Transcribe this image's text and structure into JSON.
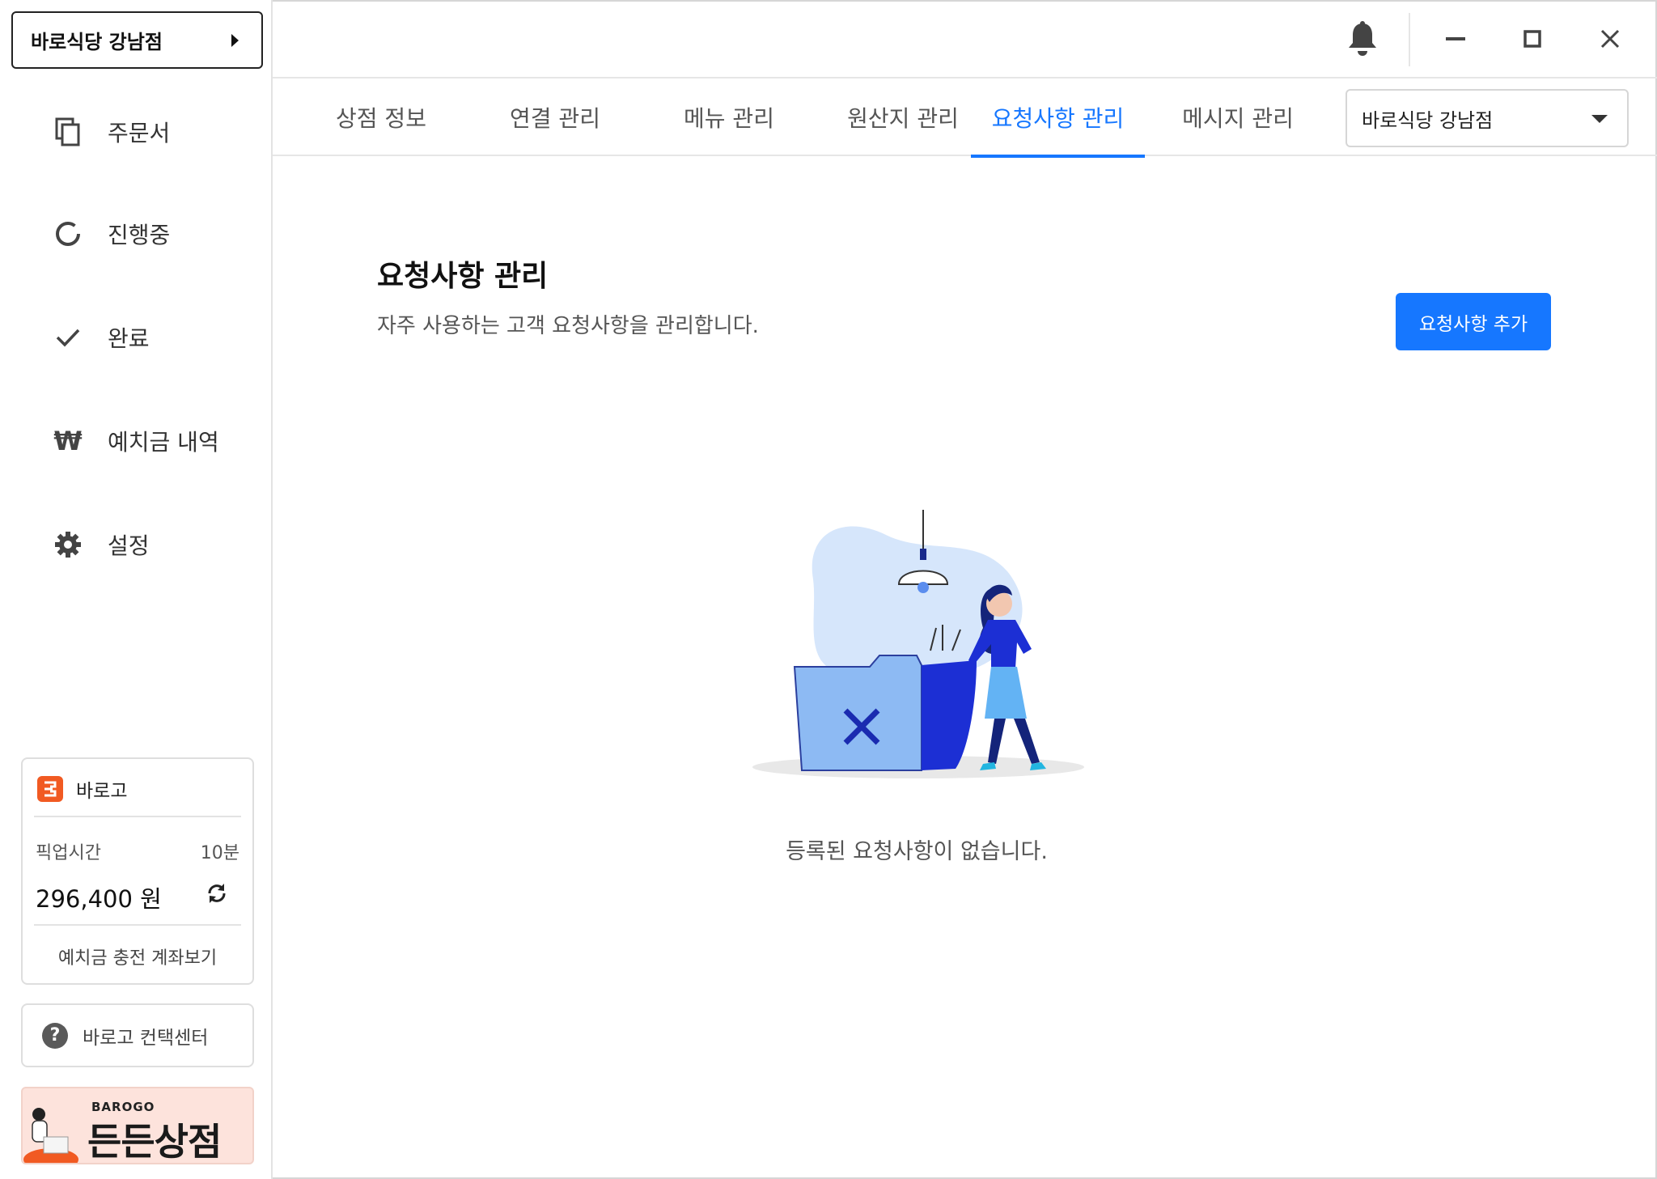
{
  "sidebar": {
    "store_button": "바로식당 강남점",
    "nav": [
      {
        "label": "주문서",
        "icon": "copy-icon"
      },
      {
        "label": "진행중",
        "icon": "progress-ring-icon"
      },
      {
        "label": "완료",
        "icon": "check-icon"
      },
      {
        "label": "예치금 내역",
        "icon": "won-icon"
      },
      {
        "label": "설정",
        "icon": "gear-icon"
      }
    ],
    "barogo_card": {
      "brand": "바로고",
      "pickup_label": "픽업시간",
      "pickup_value": "10분",
      "balance": "296,400 원",
      "view_account": "예치금 충전 계좌보기"
    },
    "contact": "바로고 컨택센터",
    "banner": {
      "small": "BAROGO",
      "big": "든든상점"
    }
  },
  "tabs": [
    "상점 정보",
    "연결 관리",
    "메뉴 관리",
    "원산지 관리",
    "요청사항 관리",
    "메시지 관리"
  ],
  "active_tab": "요청사항 관리",
  "store_select": "바로식당 강남점",
  "main": {
    "title": "요청사항 관리",
    "description": "자주 사용하는 고객 요청사항을 관리합니다.",
    "add_button": "요청사항 추가",
    "empty_message": "등록된 요청사항이 없습니다."
  },
  "colors": {
    "accent": "#1677ff",
    "brand": "#f15a22"
  }
}
